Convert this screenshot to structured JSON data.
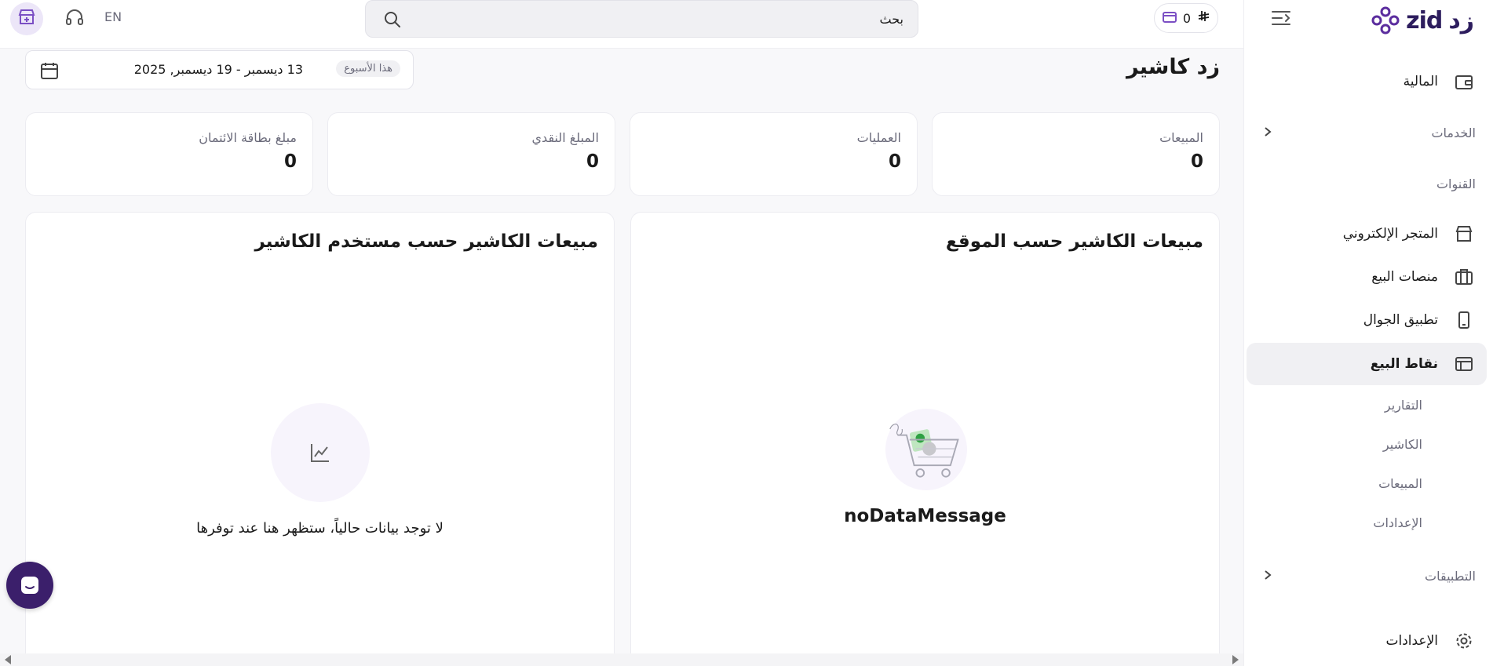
{
  "brand": {
    "arabic_name": "زد",
    "latin_name": "zid",
    "accent": "#5b2d9e"
  },
  "sidebar": {
    "items": [
      {
        "label": "المالية",
        "icon": "wallet-icon"
      },
      {
        "label": "الخدمات",
        "icon": "chevron-right-icon"
      },
      {
        "label": "القنوات"
      },
      {
        "label": "المتجر الإلكتروني",
        "icon": "store-icon"
      },
      {
        "label": "منصات البيع",
        "icon": "briefcase-icon"
      },
      {
        "label": "تطبيق الجوال",
        "icon": "mobile-icon"
      },
      {
        "label": "نقاط البيع",
        "icon": "pos-icon",
        "active": true
      },
      {
        "label": "التطبيقات",
        "icon": "chevron-right-icon"
      },
      {
        "label": "الإعدادات",
        "icon": "gear-icon"
      }
    ],
    "pos_subitems": [
      "التقارير",
      "الكاشير",
      "المبيعات",
      "الإعدادات"
    ]
  },
  "topbar": {
    "wallet_balance": "0",
    "search_placeholder": "بحث",
    "language": "EN"
  },
  "main": {
    "title": "زد كاشير",
    "date_filter": {
      "badge": "هذا الأسبوع",
      "range": "13 ديسمبر - 19 ديسمبر, 2025"
    },
    "stats": [
      {
        "label": "المبيعات",
        "value": "0"
      },
      {
        "label": "العمليات",
        "value": "0"
      },
      {
        "label": "المبلغ النقدي",
        "value": "0"
      },
      {
        "label": "مبلغ بطاقة الائتمان",
        "value": "0"
      }
    ],
    "panels": {
      "by_location": {
        "title": "مبيعات الكاشير حسب الموقع",
        "empty_message": "noDataMessage"
      },
      "by_user": {
        "title": "مبيعات الكاشير حسب مستخدم الكاشير",
        "empty_message": "لا توجد بيانات حالياً، ستظهر هنا عند توفرها"
      }
    }
  }
}
